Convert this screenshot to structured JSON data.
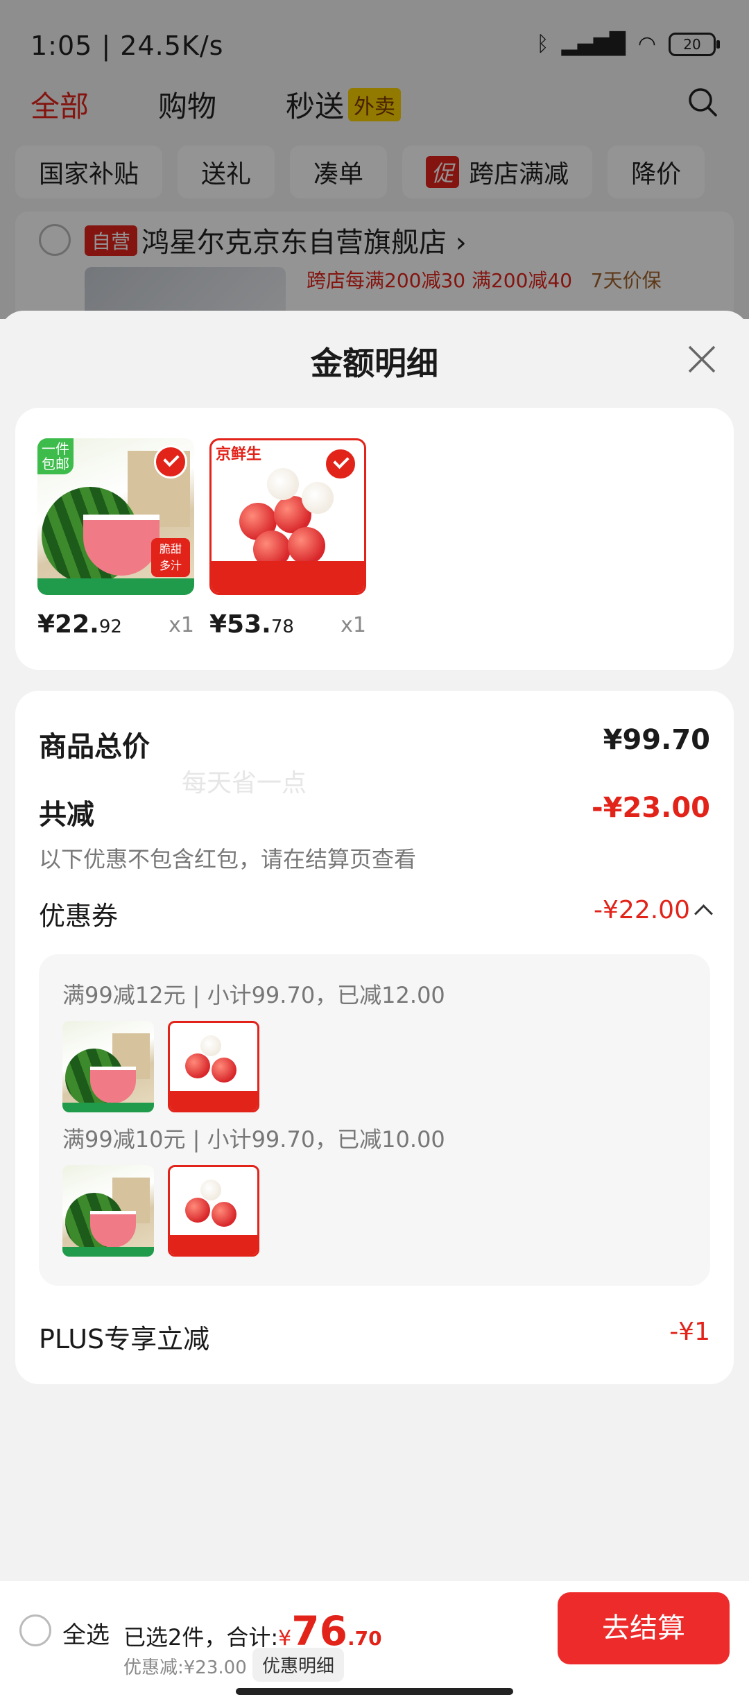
{
  "status_bar": {
    "time": "1:05 | 24.5K/s",
    "battery": "20"
  },
  "top_tabs": [
    {
      "label": "全部",
      "active": true
    },
    {
      "label": "购物",
      "active": false
    },
    {
      "label": "秒送",
      "badge": "外卖",
      "active": false
    }
  ],
  "chips": [
    {
      "label": "国家补贴"
    },
    {
      "label": "送礼"
    },
    {
      "label": "凑单"
    },
    {
      "label": "跨店满减",
      "promo": "促"
    },
    {
      "label": "降价"
    }
  ],
  "store": {
    "tag": "自营",
    "name": "鸿星尔克京东自营旗舰店",
    "promo": "跨店每满200减30  满200减40",
    "promo_gold": "7天价保"
  },
  "sheet": {
    "title": "金额明细",
    "products": [
      {
        "price_int": "¥22.",
        "price_dec": "92",
        "qty": "x1",
        "thumb": "watermelon"
      },
      {
        "price_int": "¥53.",
        "price_dec": "78",
        "qty": "x1",
        "thumb": "lychee"
      }
    ],
    "total_label": "商品总价",
    "total_value": "¥99.70",
    "discount_label": "共减",
    "discount_value": "-¥23.00",
    "discount_note": "以下优惠不包含红包，请在结算页查看",
    "watermark": "每天省一点",
    "coupon_label": "优惠券",
    "coupon_value": "-¥22.00",
    "coupon_lines": [
      "满99减12元 | 小计99.70，已减12.00",
      "满99减10元 | 小计99.70，已减10.00"
    ],
    "plus_label": "PLUS专享立减",
    "plus_value": "-¥1"
  },
  "bottom": {
    "select_all": "全选",
    "selected": "已选2件，合计:",
    "currency": "¥",
    "total_int": "76",
    "total_dec": ".70",
    "discount": "优惠减:¥23.00",
    "detail_button": "优惠明细",
    "checkout": "去结算"
  },
  "colors": {
    "accent": "#e2231a",
    "checkout": "#ee2b2b",
    "sheet_bg": "#f2f2f2"
  }
}
